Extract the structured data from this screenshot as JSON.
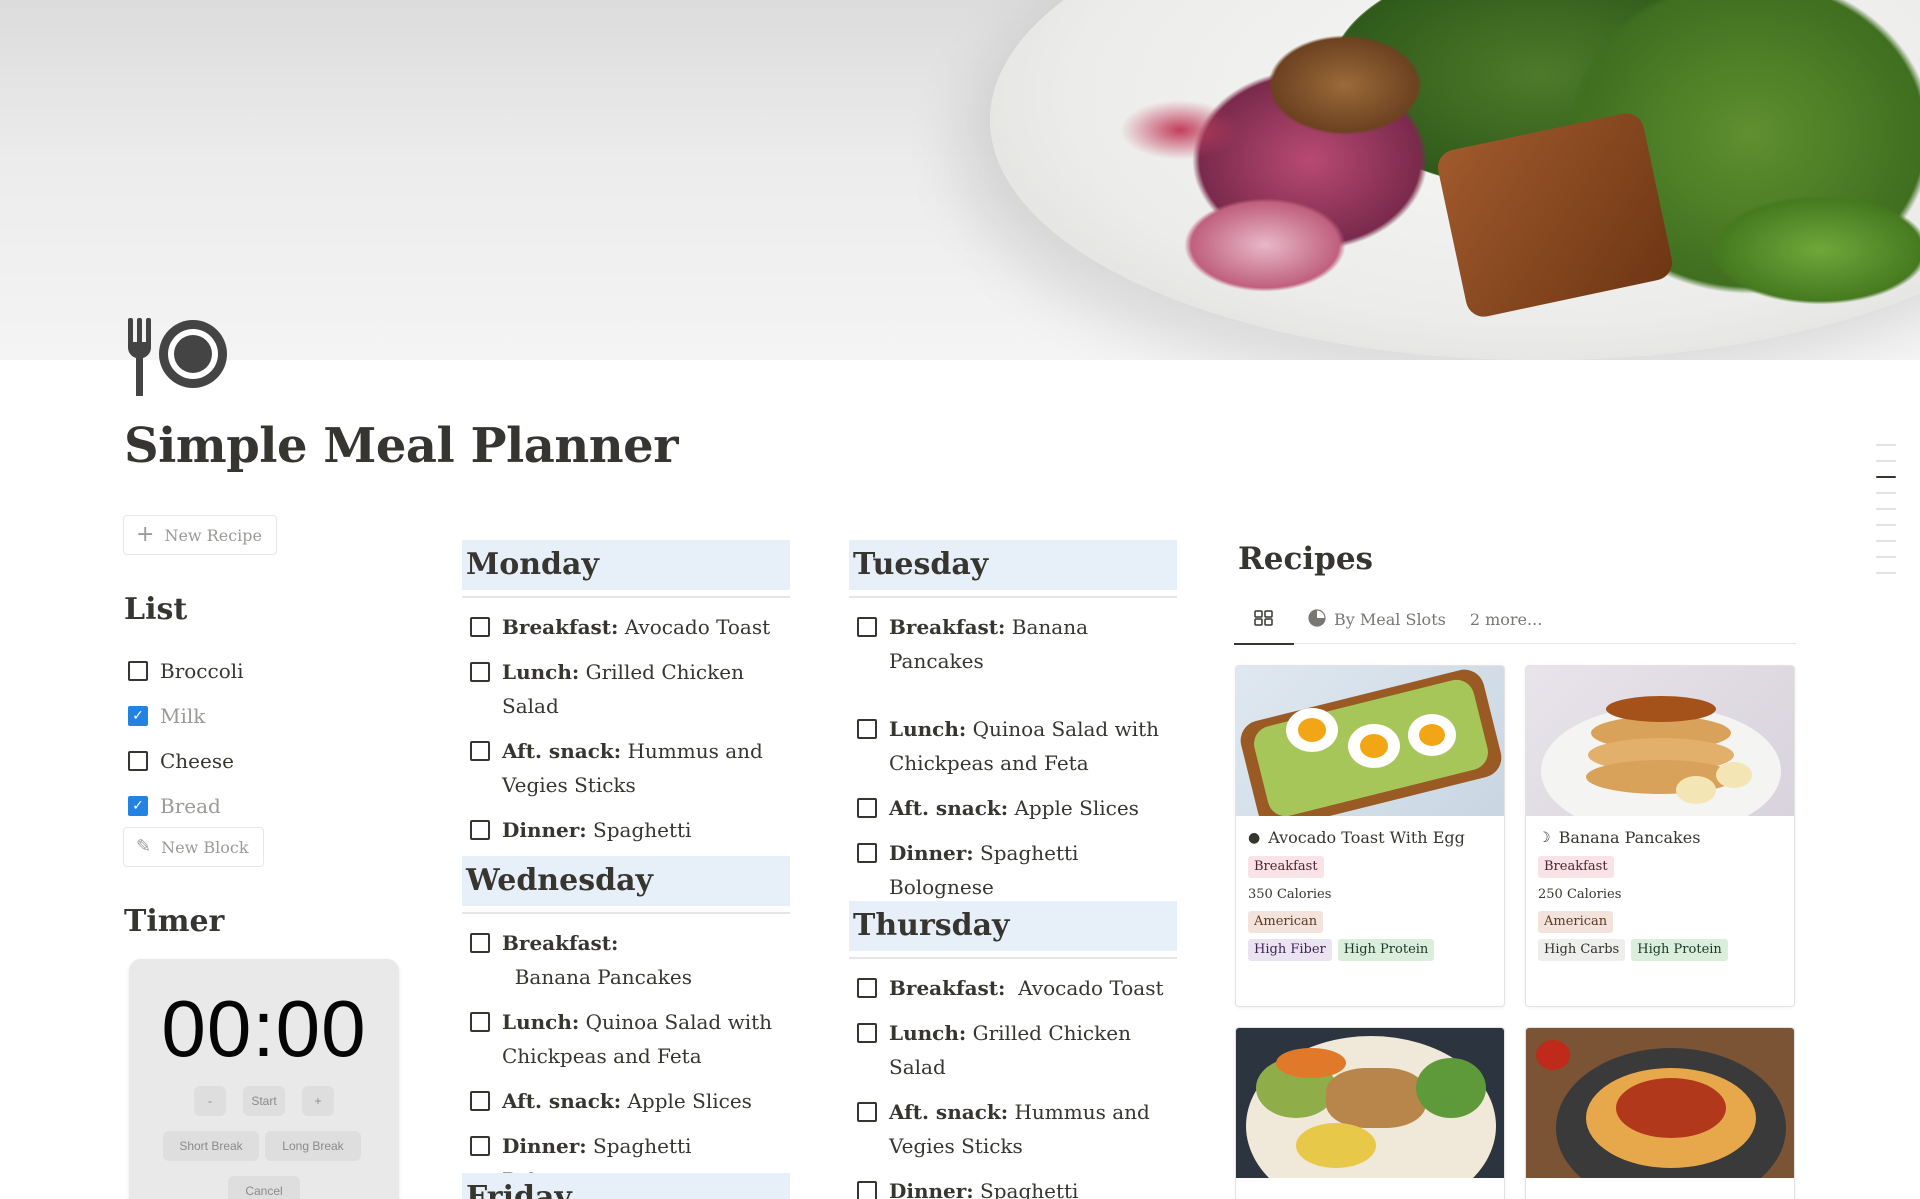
{
  "page": {
    "title": "Simple Meal Planner",
    "icon": "fork-and-plate-icon"
  },
  "left": {
    "new_recipe_label": "New Recipe",
    "list_heading": "List",
    "list_items": [
      {
        "label": "Broccoli",
        "checked": false
      },
      {
        "label": "Milk",
        "checked": true
      },
      {
        "label": "Cheese",
        "checked": false
      },
      {
        "label": "Bread",
        "checked": true
      }
    ],
    "new_block_label": "New Block",
    "timer_heading": "Timer",
    "timer": {
      "time": "00:00",
      "minus": "-",
      "start": "Start",
      "plus": "+",
      "short_break": "Short Break",
      "long_break": "Long Break",
      "cancel": "Cancel"
    }
  },
  "days": {
    "monday": {
      "name": "Monday",
      "meals": [
        {
          "label": "Breakfast:",
          "text": " Avocado Toast"
        },
        {
          "label": "Lunch:",
          "text": " Grilled Chicken Salad"
        },
        {
          "label": "Aft. snack:",
          "text": " Hummus and Vegies Sticks"
        },
        {
          "label": "Dinner:",
          "text": " Spaghetti Bolognese"
        }
      ]
    },
    "tuesday": {
      "name": "Tuesday",
      "meals": [
        {
          "label": "Breakfast:",
          "text": " Banana Pancakes"
        },
        {
          "label": "Lunch:",
          "text": " Quinoa Salad with Chickpeas and Feta"
        },
        {
          "label": "Aft. snack:",
          "text": " Apple Slices"
        },
        {
          "label": "Dinner:",
          "text": " Spaghetti Bolognese"
        }
      ]
    },
    "wednesday": {
      "name": "Wednesday",
      "meals": [
        {
          "label": "Breakfast:",
          "text": "  Banana Pancakes"
        },
        {
          "label": "Lunch:",
          "text": "  Quinoa Salad with Chickpeas and Feta"
        },
        {
          "label": "Aft. snack:",
          "text": " Apple Slices"
        },
        {
          "label": "Dinner:",
          "text": " Spaghetti Bolognese"
        }
      ]
    },
    "thursday": {
      "name": "Thursday",
      "meals": [
        {
          "label": "Breakfast:",
          "text": "  Avocado Toast"
        },
        {
          "label": "Lunch:",
          "text": " Grilled Chicken Salad"
        },
        {
          "label": "Aft. snack:",
          "text": " Hummus and Vegies Sticks"
        },
        {
          "label": "Dinner:",
          "text": " Spaghetti Bolognese"
        }
      ]
    },
    "friday": {
      "name": "Friday"
    }
  },
  "recipes": {
    "heading": "Recipes",
    "tabs": [
      {
        "label": "",
        "icon": "gallery-icon",
        "active": true
      },
      {
        "label": "By Meal Slots",
        "icon": "pie-chart-icon"
      },
      {
        "label": "2 more...",
        "icon": ""
      }
    ],
    "cards": [
      {
        "name": "Avocado Toast With Egg",
        "icon": "avocado-icon",
        "meal": "Breakfast",
        "calories": "350 Calories",
        "cuisine": "American",
        "nutrition": [
          "High Fiber",
          "High Protein"
        ]
      },
      {
        "name": "Banana Pancakes",
        "icon": "banana-icon",
        "meal": "Breakfast",
        "calories": "250 Calories",
        "cuisine": "American",
        "nutrition": [
          "High Carbs",
          "High Protein"
        ]
      }
    ]
  },
  "colors": {
    "accent": "#2383e2",
    "day_header_bg": "#e7f0f8",
    "text": "#37352f"
  }
}
